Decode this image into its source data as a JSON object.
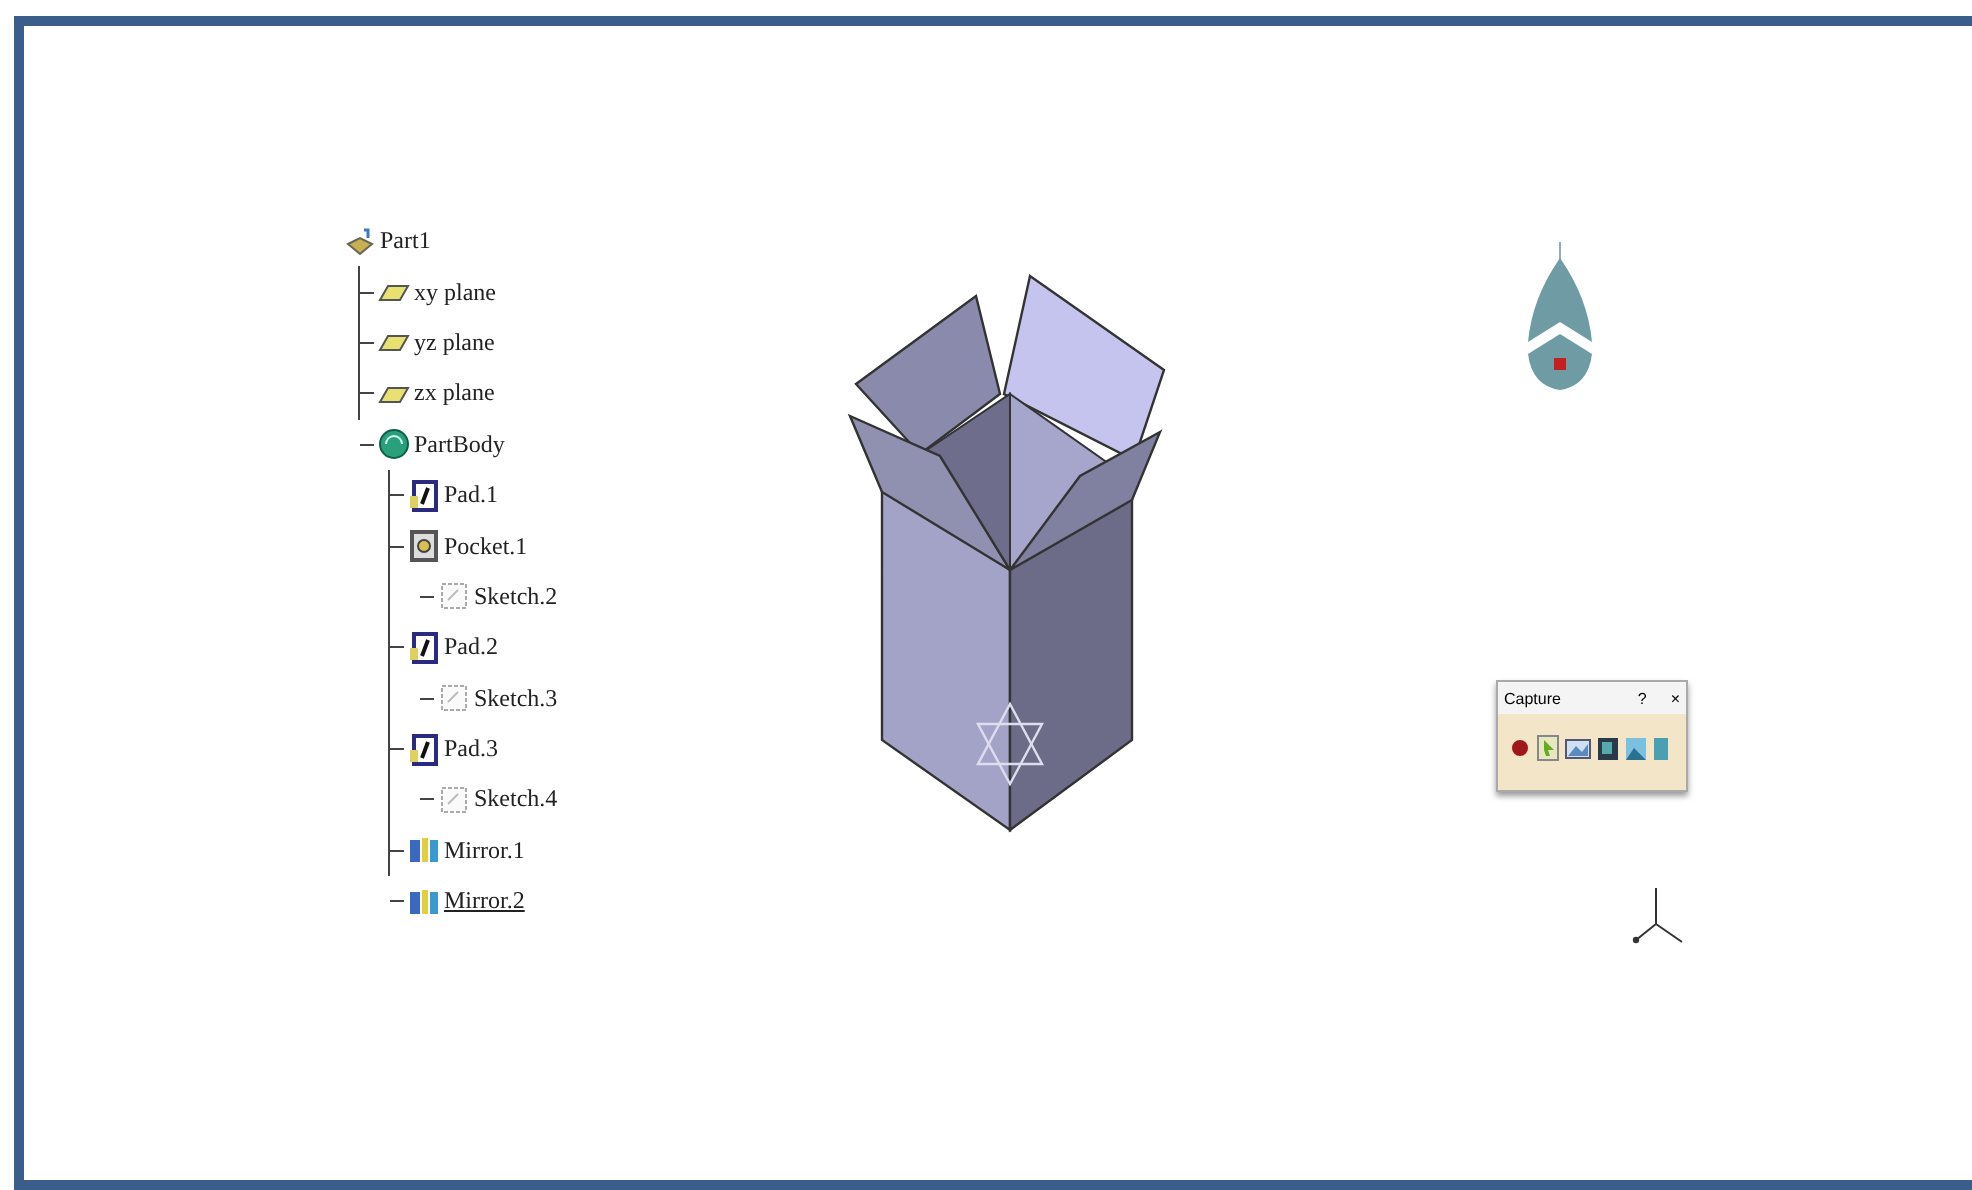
{
  "tree": {
    "label": "Part1",
    "kind": "part",
    "current": false,
    "children": [
      {
        "label": "xy plane",
        "kind": "plane",
        "current": false
      },
      {
        "label": "yz plane",
        "kind": "plane",
        "current": false
      },
      {
        "label": "zx plane",
        "kind": "plane",
        "current": false
      },
      {
        "label": "PartBody",
        "kind": "body",
        "current": false,
        "children": [
          {
            "label": "Pad.1",
            "kind": "pad",
            "current": false
          },
          {
            "label": "Pocket.1",
            "kind": "pocket",
            "current": false,
            "children": [
              {
                "label": "Sketch.2",
                "kind": "sketch",
                "current": false
              }
            ]
          },
          {
            "label": "Pad.2",
            "kind": "pad",
            "current": false,
            "children": [
              {
                "label": "Sketch.3",
                "kind": "sketch",
                "current": false
              }
            ]
          },
          {
            "label": "Pad.3",
            "kind": "pad",
            "current": false,
            "children": [
              {
                "label": "Sketch.4",
                "kind": "sketch",
                "current": false
              }
            ]
          },
          {
            "label": "Mirror.1",
            "kind": "mirror",
            "current": false
          },
          {
            "label": "Mirror.2",
            "kind": "mirror",
            "current": true
          }
        ]
      }
    ]
  },
  "capture_toolbar": {
    "title": "Capture",
    "help": "?",
    "close": "×"
  }
}
